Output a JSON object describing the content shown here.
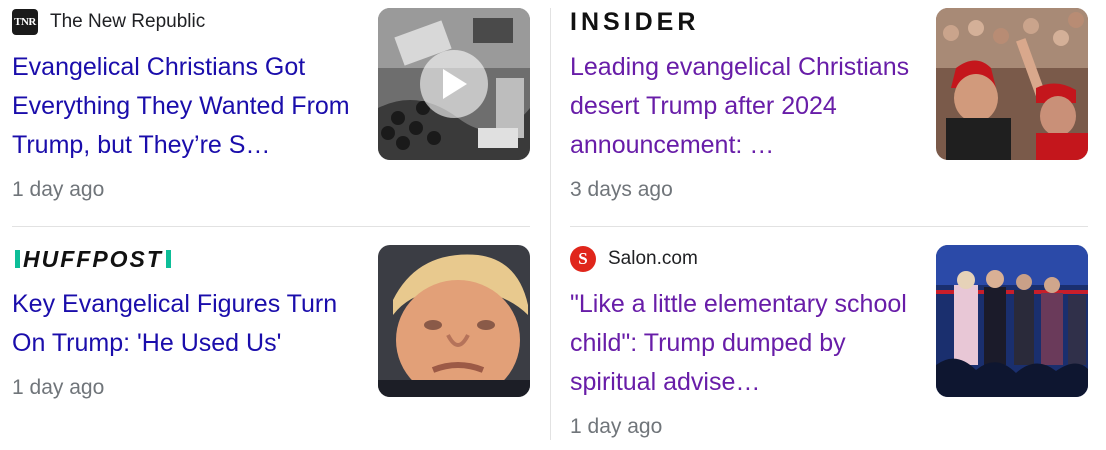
{
  "cards": [
    {
      "source": "The New Republic",
      "logo_text": "TNR",
      "headline": "Evangelical Christians Got Everything They Wanted From Trump, but They’re S…",
      "time": "1 day ago",
      "thumbnail": "typewriter-video-thumbnail",
      "has_play": true
    },
    {
      "source": "INSIDER",
      "headline": "Leading evangelical Christians desert Trump after 2024 announcement: …",
      "time": "3 days ago",
      "thumbnail": "crowd-rally-thumbnail"
    },
    {
      "source": "HUFFPOST",
      "headline": "Key Evangelical Figures Turn On Trump: 'He Used Us'",
      "time": "1 day ago",
      "thumbnail": "trump-portrait-thumbnail"
    },
    {
      "source": "Salon.com",
      "logo_text": "S",
      "headline": "\"Like a little elementary school child\": Trump dumped by spiritual advise…",
      "time": "1 day ago",
      "thumbnail": "stage-prayer-thumbnail"
    }
  ],
  "colors": {
    "link_unvisited": "#1a0dab",
    "link_visited": "#681da8",
    "timestamp": "#70757a",
    "huffpost_accent": "#0dbe98",
    "salon_red": "#e0261b"
  }
}
